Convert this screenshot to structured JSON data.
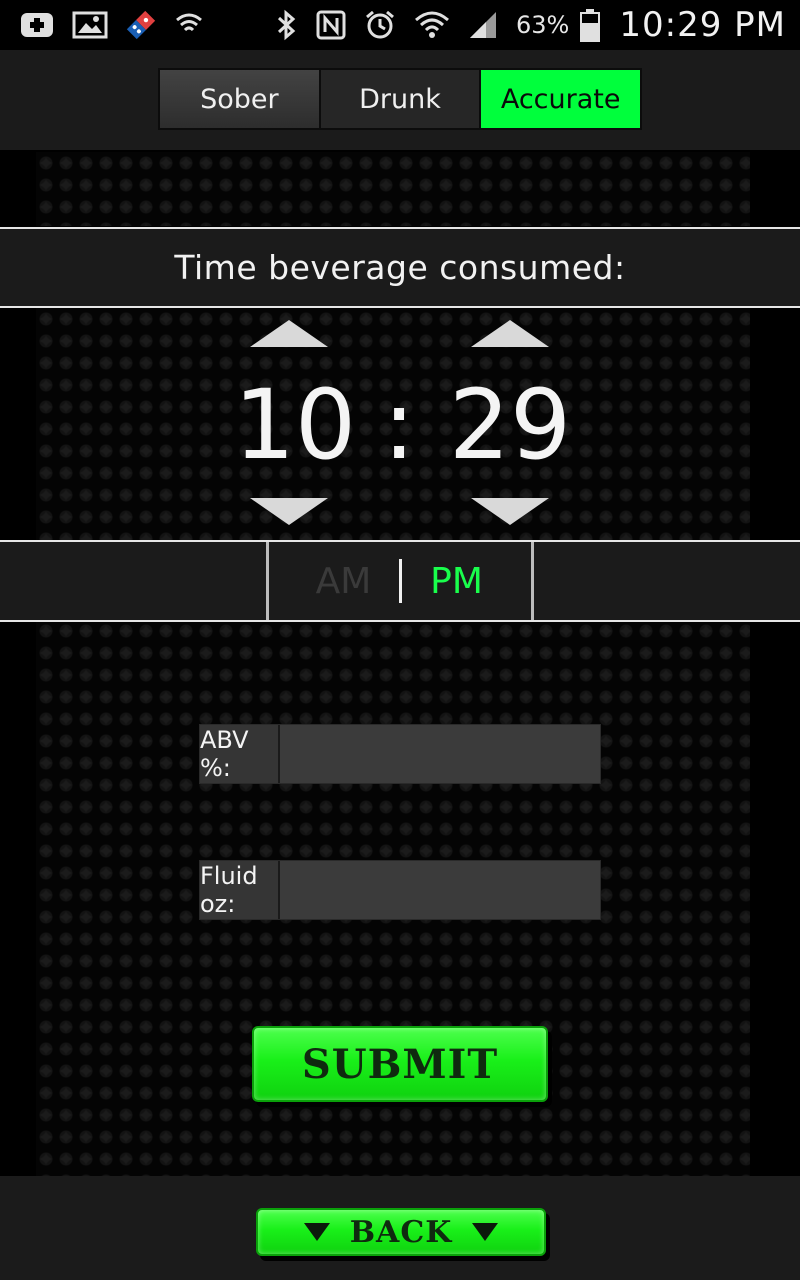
{
  "status_bar": {
    "battery_percent": "63%",
    "time": "10:29 PM",
    "icons": [
      "add-icon",
      "image-icon",
      "dominos-icon",
      "lookout-shield-icon",
      "bluetooth-icon",
      "nfc-icon",
      "alarm-icon",
      "wifi-icon",
      "signal-icon",
      "battery-icon"
    ]
  },
  "mode_tabs": [
    {
      "label": "Sober"
    },
    {
      "label": "Drunk"
    },
    {
      "label": "Accurate"
    }
  ],
  "active_mode": "Accurate",
  "time_section": {
    "label": "Time beverage consumed:",
    "hour": "10",
    "colon": ":",
    "minute": "29",
    "am": "AM",
    "pm": "PM",
    "selected_period": "PM"
  },
  "form": {
    "abv_label": "ABV %:",
    "abv_value": "",
    "oz_label": "Fluid oz:",
    "oz_value": ""
  },
  "buttons": {
    "submit": "SUBMIT",
    "back": "BACK"
  },
  "colors": {
    "accent_green": "#00ff3c",
    "pm_green": "#19ff4c",
    "background": "#000000"
  }
}
